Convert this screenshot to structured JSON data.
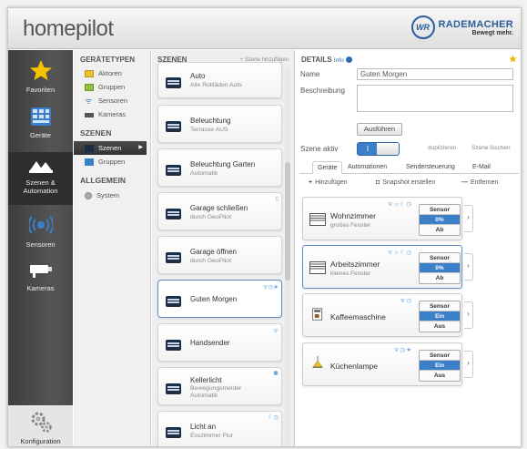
{
  "header": {
    "app_title": "homepilot",
    "brand": "RADEMACHER",
    "brand_tagline": "Bewegt mehr.",
    "logo_mark": "WR"
  },
  "nav": {
    "items": [
      {
        "label": "Favoriten",
        "icon": "star-icon"
      },
      {
        "label": "Geräte",
        "icon": "devices-icon"
      },
      {
        "label": "Szenen & Automation",
        "icon": "scenes-icon"
      },
      {
        "label": "Sensoren",
        "icon": "sensor-icon"
      },
      {
        "label": "Kameras",
        "icon": "camera-icon"
      }
    ],
    "bottom_label": "Konfiguration"
  },
  "types": {
    "header": "GERÄTETYPEN",
    "items": [
      "Aktoren",
      "Gruppen",
      "Sensoren",
      "Kameras"
    ],
    "scenes_header": "SZENEN",
    "scene_items": [
      "Szenen",
      "Gruppen"
    ],
    "general_header": "ALLGEMEIN",
    "general_items": [
      "System"
    ]
  },
  "scenes": {
    "header": "SZENEN",
    "add_label": "+ Szene hinzufügen",
    "cards": [
      {
        "title": "Auto",
        "subtitle": "Alle Rollläden Auts",
        "status": ""
      },
      {
        "title": "Beleuchtung",
        "subtitle": "Terrasse AUS",
        "status": ""
      },
      {
        "title": "Beleuchtung Garten",
        "subtitle": "Automatik",
        "status": ""
      },
      {
        "title": "Garage schließen",
        "subtitle": "durch GeoPilot",
        "status": "▯"
      },
      {
        "title": "Garage öffnen",
        "subtitle": "durch GeoPilot",
        "status": ""
      },
      {
        "title": "Guten Morgen",
        "subtitle": "",
        "status": "ᯤ◷★"
      },
      {
        "title": "Handsender",
        "subtitle": "",
        "status": "ᯤ"
      },
      {
        "title": "Kellerlicht",
        "subtitle": "Bewegungsmelder",
        "subtitle2": "Automatik",
        "status": "⚈"
      },
      {
        "title": "Licht an",
        "subtitle": "Esszimmer Flur",
        "status": "☾◷"
      }
    ]
  },
  "details": {
    "header": "DETAILS",
    "info_label": "Info",
    "name_label": "Name",
    "name_value": "Guten Morgen",
    "desc_label": "Beschreibung",
    "run_label": "Ausführen",
    "active_label": "Szene aktiv",
    "toggle_on": "I",
    "duplicate_label": "duplizieren",
    "delete_label": "Szene löschen",
    "tabs": [
      "Geräte",
      "Automationen",
      "Sendersteuerung",
      "E-Mail"
    ],
    "add_label": "Hinzufügen",
    "snapshot_label": "Snapshot erstellen",
    "remove_label": "Entfernen",
    "devices": [
      {
        "name": "Wohnzimmer",
        "desc": "großes Fenster",
        "status": "ᯤ☼☾◷",
        "ctrl": [
          "Sensor",
          "0%",
          "Ab"
        ]
      },
      {
        "name": "Arbeitszimmer",
        "desc": "kleines Fenster",
        "status": "ᯤ☼☾◷",
        "ctrl": [
          "Sensor",
          "0%",
          "Ab"
        ]
      },
      {
        "name": "Kaffeemaschine",
        "desc": "",
        "status": "ᯤ◷",
        "ctrl": [
          "Sensor",
          "Ein",
          "Aus"
        ]
      },
      {
        "name": "Küchenlampe",
        "desc": "",
        "status": "ᯤ◷★",
        "ctrl": [
          "Sensor",
          "Ein",
          "Aus"
        ]
      }
    ]
  },
  "colors": {
    "accent": "#3b7fc8",
    "star": "#f0b400",
    "nav_bg": "#4a4a4a",
    "brand": "#2a5d9b"
  }
}
